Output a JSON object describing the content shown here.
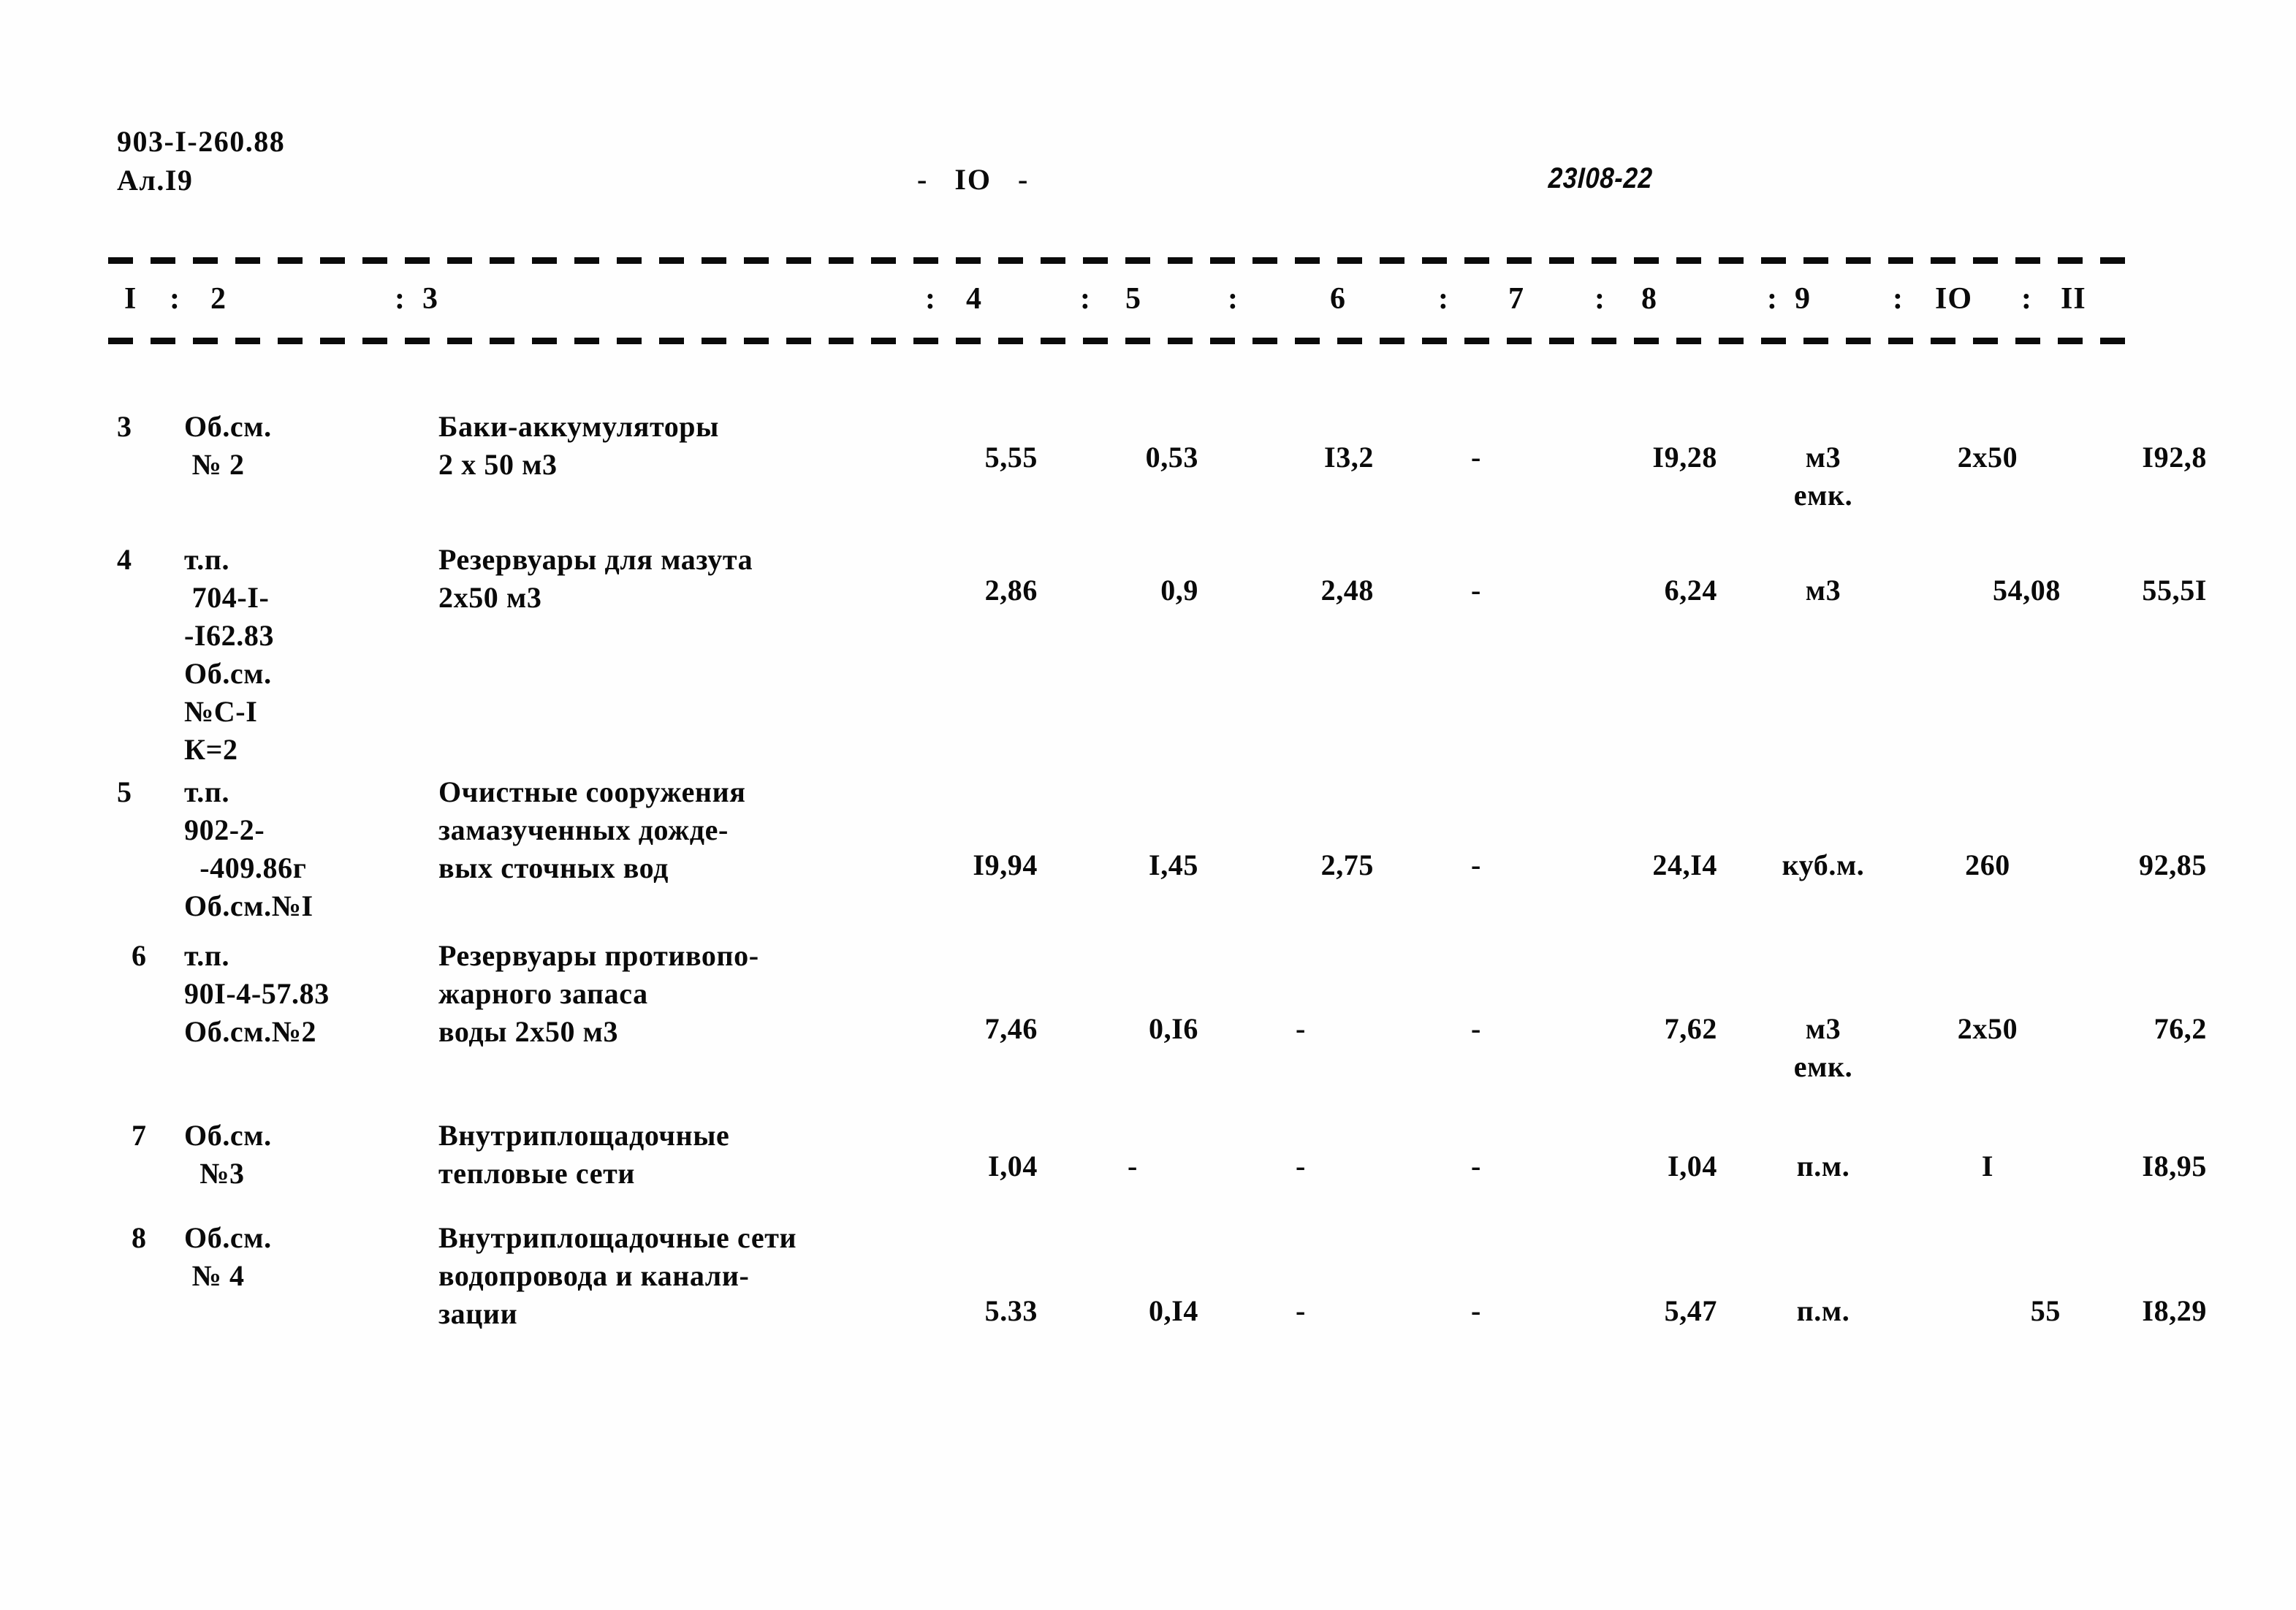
{
  "header": {
    "doc_code": "903-I-260.88",
    "sheet_label": "Ал.I9",
    "page_marker": "-   IO   -",
    "stamp": "23I08-22"
  },
  "table": {
    "column_headers": [
      "I",
      "2",
      "3",
      "4",
      "5",
      "6",
      "7",
      "8",
      "9",
      "IO",
      "II"
    ],
    "separator": ":",
    "rows": [
      {
        "no": "3",
        "code": "Об.см.\n № 2",
        "name": "Баки-аккумуляторы\n2 х 50 м3",
        "c4": "5,55",
        "c5": "0,53",
        "c6": "I3,2",
        "c7": "-",
        "c8": "I9,28",
        "c9": "м3\nемк.",
        "c10": "2х50",
        "c11": "I92,8"
      },
      {
        "no": "4",
        "code": "т.п.\n 704-I-\n-I62.83\nОб.см.\n№С-I\nК=2",
        "name": "Резервуары для мазута\n2х50 м3",
        "c4": "2,86",
        "c5": "0,9",
        "c6": "2,48",
        "c7": "-",
        "c8": "6,24",
        "c9": "м3",
        "c10": "54,08",
        "c11": "55,5I"
      },
      {
        "no": "5",
        "code": "т.п.\n902-2-\n  -409.86г\nОб.см.№I",
        "name": "Очистные сооружения\nзамазученных дожде-\nвых сточных вод",
        "c4": "I9,94",
        "c5": "I,45",
        "c6": "2,75",
        "c7": "-",
        "c8": "24,I4",
        "c9": "куб.м.",
        "c10": "260",
        "c11": "92,85"
      },
      {
        "no": "6",
        "code": "т.п.\n90I-4-57.83\nОб.см.№2",
        "name": "Резервуары противопо-\nжарного запаса\nводы 2х50 м3",
        "c4": "7,46",
        "c5": "0,I6",
        "c6": "-",
        "c7": "-",
        "c8": "7,62",
        "c9": "м3\nемк.",
        "c10": "2х50",
        "c11": "76,2"
      },
      {
        "no": "7",
        "code": "Об.см.\n  №3",
        "name": "Внутриплощадочные\nтепловые сети",
        "c4": "I,04",
        "c5": "-",
        "c6": "-",
        "c7": "-",
        "c8": "I,04",
        "c9": "п.м.",
        "c10": "I",
        "c11": "I8,95"
      },
      {
        "no": "8",
        "code": "Об.см.\n № 4",
        "name": "Внутриплощадочные сети\nводопровода и канали-\nзации",
        "c4": "5.33",
        "c5": "0,I4",
        "c6": "-",
        "c7": "-",
        "c8": "5,47",
        "c9": "п.м.",
        "c10": "55",
        "c11": "I8,29"
      }
    ]
  }
}
